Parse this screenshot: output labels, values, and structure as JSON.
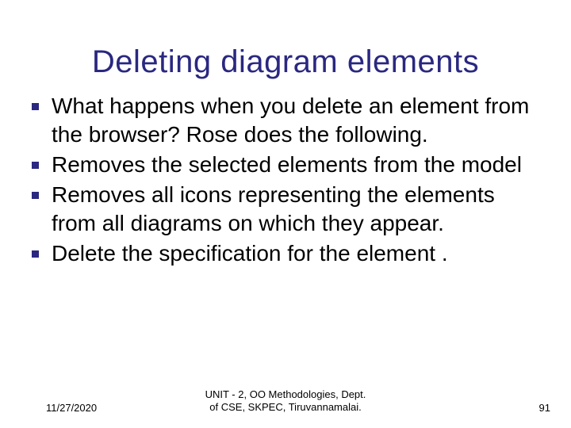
{
  "title": "Deleting diagram elements",
  "bullets": [
    "What happens when you delete an element from the browser? Rose does the following.",
    "Removes the selected elements from the model",
    "Removes all icons representing the elements from all diagrams on which they appear.",
    "Delete the specification for the element ."
  ],
  "footer": {
    "date": "11/27/2020",
    "center": "UNIT - 2, OO Methodologies, Dept.\nof CSE, SKPEC, Tiruvannamalai.",
    "page": "91"
  }
}
